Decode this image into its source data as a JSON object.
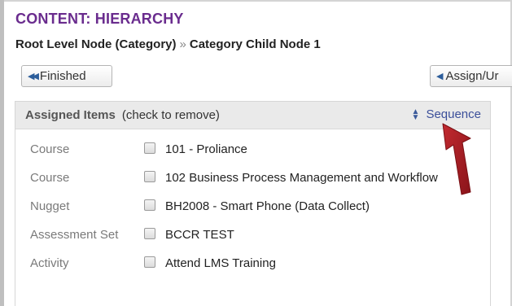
{
  "page": {
    "title": "CONTENT: HIERARCHY"
  },
  "breadcrumb": {
    "items": [
      "Root Level Node (Category)",
      "Category Child Node 1"
    ],
    "separator": "»"
  },
  "toolbar": {
    "finished_label": "Finished",
    "assign_label": "Assign/Ur"
  },
  "panel": {
    "title": "Assigned Items",
    "note": "(check to remove)",
    "sequence_label": "Sequence",
    "items": [
      {
        "type": "Course",
        "label": "101 - Proliance",
        "checked": false
      },
      {
        "type": "Course",
        "label": "102 Business Process Management and Workflow",
        "checked": false
      },
      {
        "type": "Nugget",
        "label": "BH2008 - Smart Phone (Data Collect)",
        "checked": false
      },
      {
        "type": "Assessment Set",
        "label": "BCCR TEST",
        "checked": false
      },
      {
        "type": "Activity",
        "label": "Attend LMS Training",
        "checked": false
      }
    ]
  },
  "colors": {
    "title": "#6a2c8e",
    "link": "#3b4f9a",
    "annotation_arrow": "#a01d24"
  },
  "icons": {
    "finished": "double-left-triangle-icon",
    "assign": "left-triangle-icon",
    "sequence": "sort-up-down-icon",
    "annotation": "red-arrow-annotation"
  }
}
